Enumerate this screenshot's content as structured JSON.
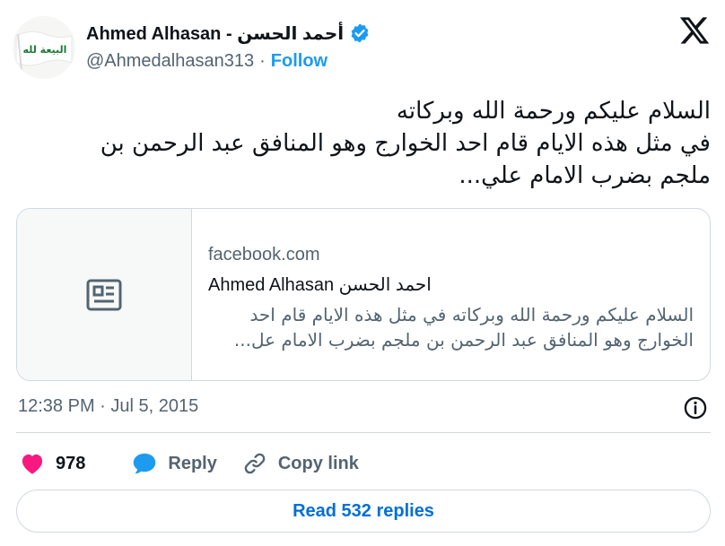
{
  "author": {
    "name": "Ahmed Alhasan - أحمد الحسن",
    "handle": "@Ahmedalhasan313",
    "separator": "·",
    "follow_label": "Follow",
    "avatar_icon": "flag-icon",
    "avatar_banner_text": "البيعة لله",
    "verified_icon": "verified-badge-icon",
    "verified_color": "#1d9bf0"
  },
  "header": {
    "logo_icon": "x-logo-icon"
  },
  "tweet": {
    "lines": [
      "السلام عليكم ورحمة الله وبركاته",
      "في مثل هذه الايام قام احد الخوارج وهو المنافق عبد الرحمن بن",
      "ملجم بضرب الامام علي..."
    ]
  },
  "card": {
    "domain": "facebook.com",
    "title": "Ahmed Alhasan احمد الحسن",
    "description_lines": [
      "السلام عليكم ورحمة الله وبركاته في مثل هذه الايام قام احد",
      "الخوارج وهو المنافق عبد الرحمن بن ملجم بضرب الامام عل..."
    ],
    "thumb_icon": "article-icon"
  },
  "meta": {
    "timestamp": "12:38 PM · Jul 5, 2015",
    "info_icon": "info-icon"
  },
  "actions": {
    "like_count": "978",
    "like_color": "#f91880",
    "reply_label": "Reply",
    "reply_color": "#1d9bf0",
    "copy_link_label": "Copy link"
  },
  "read_replies_label": "Read 532 replies",
  "accent": "#1d9bf0"
}
